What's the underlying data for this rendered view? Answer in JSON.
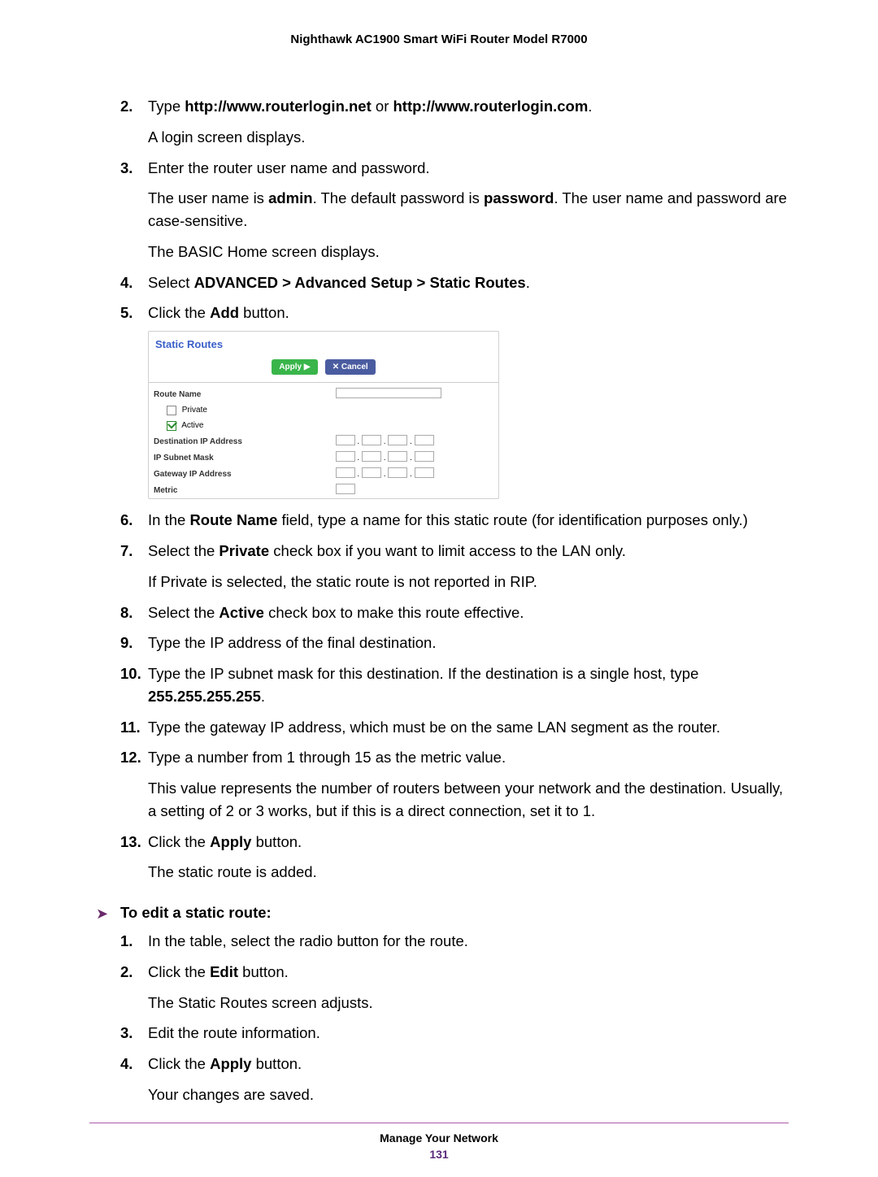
{
  "header_title": "Nighthawk AC1900 Smart WiFi Router Model R7000",
  "s2_a": "Type ",
  "s2_b": "http://www.routerlogin.net",
  "s2_c": " or ",
  "s2_d": "http://www.routerlogin.com",
  "s2_e": ".",
  "s2_p": "A login screen displays.",
  "s3": "Enter the router user name and password.",
  "s3_p1_a": "The user name is ",
  "s3_p1_b": "admin",
  "s3_p1_c": ". The default password is ",
  "s3_p1_d": "password",
  "s3_p1_e": ". The user name and password are case-sensitive.",
  "s3_p2": "The BASIC Home screen displays.",
  "s4_a": "Select ",
  "s4_b": "ADVANCED > Advanced Setup > Static Routes",
  "s4_c": ".",
  "s5_a": "Click the ",
  "s5_b": "Add",
  "s5_c": " button.",
  "ss": {
    "title": "Static Routes",
    "apply": "Apply ▶",
    "cancel": "✕ Cancel",
    "route_name": "Route Name",
    "private": "Private",
    "active": "Active",
    "dest": "Destination IP Address",
    "mask": "IP Subnet Mask",
    "gw": "Gateway IP Address",
    "metric": "Metric"
  },
  "s6_a": "In the ",
  "s6_b": "Route Name",
  "s6_c": " field, type a name for this static route (for identification purposes only.)",
  "s7_a": "Select the ",
  "s7_b": "Private",
  "s7_c": " check box if you want to limit access to the LAN only.",
  "s7_p": "If Private is selected, the static route is not reported in RIP.",
  "s8_a": "Select the ",
  "s8_b": "Active",
  "s8_c": " check box to make this route effective.",
  "s9": "Type the IP address of the final destination.",
  "s10_a": "Type the IP subnet mask for this destination. If the destination is a single host, type ",
  "s10_b": "255.255.255.255",
  "s10_c": ".",
  "s11": "Type the gateway IP address, which must be on the same LAN segment as the router.",
  "s12": "Type a number from 1 through 15 as the metric value.",
  "s12_p": "This value represents the number of routers between your network and the destination. Usually, a setting of 2 or 3 works, but if this is a direct connection, set it to 1.",
  "s13_a": "Click the ",
  "s13_b": "Apply",
  "s13_c": " button.",
  "s13_p": "The static route is added.",
  "edit_heading": "To edit a static route:",
  "e1": "In the table, select the radio button for the route.",
  "e2_a": "Click the ",
  "e2_b": "Edit",
  "e2_c": " button.",
  "e2_p": "The Static Routes screen adjusts.",
  "e3": "Edit the route information.",
  "e4_a": "Click the ",
  "e4_b": "Apply",
  "e4_c": " button.",
  "e4_p": "Your changes are saved.",
  "footer_section": "Manage Your Network",
  "footer_page": "131"
}
